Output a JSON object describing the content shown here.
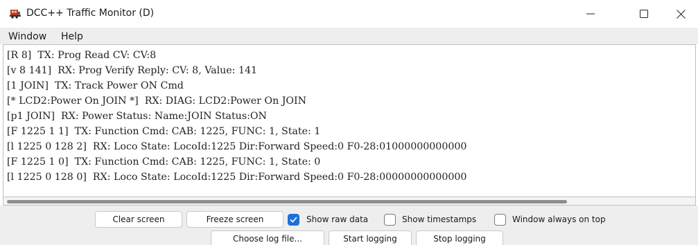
{
  "window": {
    "title": "DCC++ Traffic Monitor (D)",
    "icon": "train-icon",
    "controls": {
      "minimize": "minimize-icon",
      "maximize": "maximize-icon",
      "close": "close-icon"
    }
  },
  "menu": {
    "items": [
      {
        "label": "Window"
      },
      {
        "label": "Help"
      }
    ]
  },
  "log": {
    "lines": [
      "[R 8]  TX: Prog Read CV: CV:8",
      "[v 8 141]  RX: Prog Verify Reply: CV: 8, Value: 141",
      "[1 JOIN]  TX: Track Power ON Cmd",
      "[* LCD2:Power On JOIN *]  RX: DIAG: LCD2:Power On JOIN",
      "[p1 JOIN]  RX: Power Status: Name:JOIN Status:ON",
      "[F 1225 1 1]  TX: Function Cmd: CAB: 1225, FUNC: 1, State: 1",
      "[l 1225 0 128 2]  RX: Loco State: LocoId:1225 Dir:Forward Speed:0 F0-28:01000000000000",
      "[F 1225 1 0]  TX: Function Cmd: CAB: 1225, FUNC: 1, State: 0",
      "[l 1225 0 128 0]  RX: Loco State: LocoId:1225 Dir:Forward Speed:0 F0-28:00000000000000"
    ]
  },
  "controls": {
    "clear_screen": "Clear screen",
    "freeze_screen": "Freeze screen",
    "show_raw_data": {
      "label": "Show raw data",
      "checked": true
    },
    "show_timestamps": {
      "label": "Show timestamps",
      "checked": false
    },
    "window_always_on_top": {
      "label": "Window always on top",
      "checked": false
    },
    "choose_log_file": "Choose log file...",
    "start_logging": "Start logging",
    "stop_logging": "Stop logging"
  },
  "colors": {
    "checkbox_checked": "#1f6fd6",
    "panel_background": "#eeeeee"
  }
}
